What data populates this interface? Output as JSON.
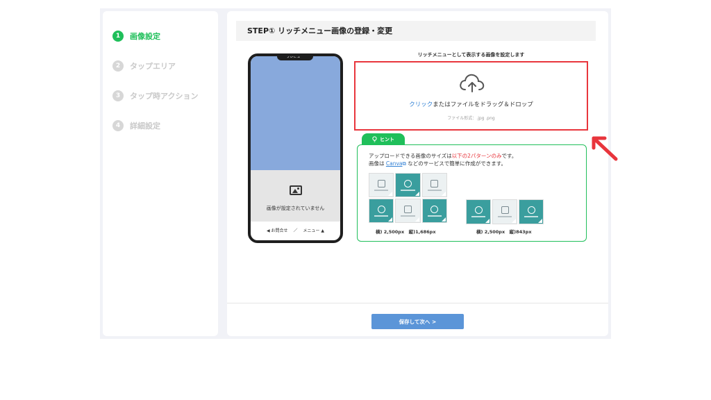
{
  "sidebar": {
    "steps": [
      {
        "num": "1",
        "label": "画像設定"
      },
      {
        "num": "2",
        "label": "タップエリア"
      },
      {
        "num": "3",
        "label": "タップ時アクション"
      },
      {
        "num": "4",
        "label": "詳細設定"
      }
    ]
  },
  "main": {
    "title": "STEP① リッチメニュー画像の登録・変更",
    "preview": {
      "notch_label": "プレビュー",
      "empty_caption": "画像が設定されていません",
      "bottom_left": "◀ お問合せ",
      "bottom_sep": "／",
      "bottom_right": "メニュー ▲"
    },
    "upload": {
      "caption": "リッチメニューとして表示する画像を設定します",
      "link_text": "クリック",
      "main_text": "またはファイルをドラッグ＆ドロップ",
      "format_text": "ファイル形式：.jpg .png"
    },
    "hint": {
      "tab_label": "ヒント",
      "line1_pre": "アップロードできる画像のサイズは",
      "line1_red": "以下の2パターンのみ",
      "line1_post": "です。",
      "line2_pre": "画像は",
      "line2_link": "Canva",
      "line2_post": "などのサービスで簡単に作成ができます。",
      "size_large": "横) 2,500px　縦)1,686px",
      "size_small": "横) 2,500px　縦)843px"
    },
    "save_label": "保存して次へ >"
  },
  "colors": {
    "accent_green": "#1fbf5a",
    "drop_red": "#e8353c",
    "button_blue": "#5b95d8",
    "preview_blue": "#88a9dc"
  }
}
